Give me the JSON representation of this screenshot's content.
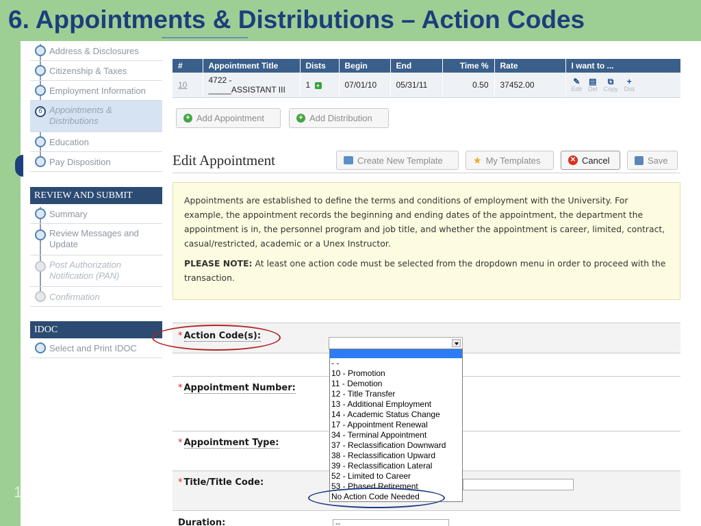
{
  "slide": {
    "title": "6. Appointments & Distributions – Action Codes"
  },
  "sidebar": {
    "top_items": [
      {
        "label": "Address & Disclosures"
      },
      {
        "label": "Citizenship & Taxes"
      },
      {
        "label": "Employment Information"
      },
      {
        "label": "Appointments & Distributions",
        "step": "6"
      },
      {
        "label": "Education"
      },
      {
        "label": "Pay Disposition"
      }
    ],
    "review_header": "REVIEW AND SUBMIT",
    "review_items": [
      {
        "label": "Summary"
      },
      {
        "label": "Review Messages and Update"
      },
      {
        "label": "Post Authorization Notification (PAN)"
      },
      {
        "label": "Confirmation"
      }
    ],
    "idoc_header": "IDOC",
    "idoc_items": [
      {
        "label": "Select and Print IDOC"
      }
    ]
  },
  "table": {
    "headers": [
      "#",
      "Appointment Title",
      "Dists",
      "Begin",
      "End",
      "Time %",
      "Rate",
      "I want to ..."
    ],
    "row": {
      "num": "10",
      "title_line1": "4722 -",
      "title_line2": "_____ASSISTANT III",
      "dists": "1",
      "begin": "07/01/10",
      "end": "05/31/11",
      "time": "0.50",
      "rate": "37452.00"
    },
    "actions": [
      "Edit",
      "Del",
      "Copy",
      "Dist"
    ]
  },
  "buttons": {
    "add_appointment": "Add Appointment",
    "add_distribution": "Add Distribution",
    "create_template": "Create New Template",
    "my_templates": "My Templates",
    "cancel": "Cancel",
    "save": "Save"
  },
  "edit": {
    "title": "Edit Appointment"
  },
  "notice": {
    "paragraph": "Appointments are established to define the terms and conditions of employment with the University. For example, the appointment records the beginning and ending dates of the appointment, the department the appointment is in, the personnel program and job title, and whether the appointment is career, limited, contract, casual/restricted, academic or a Unex Instructor.",
    "note_label": "PLEASE NOTE:",
    "note_text": " At least one action code must be selected from the dropdown menu in order to proceed with the transaction."
  },
  "form": {
    "required_mark": "*",
    "action_code_label": "Action Code(s):",
    "appointment_number_label": "Appointment Number:",
    "appointment_type_label": "Appointment Type:",
    "title_code_label": "Title/Title Code:",
    "duration_label": "Duration:",
    "duration_value": "--"
  },
  "dropdown": {
    "options": [
      "",
      "- -",
      "10 - Promotion",
      "11 - Demotion",
      "12 - Title Transfer",
      "13 - Additional Employment",
      "14 - Academic Status Change",
      "17 - Appointment Renewal",
      "34 - Terminal Appointment",
      "37 - Reclassification Downward",
      "38 - Reclassification Upward",
      "39 - Reclassification Lateral",
      "52 - Limited to Career",
      "53 - Phased Retirement",
      "No Action Code Needed"
    ]
  },
  "colors": {
    "slide_bg": "#9dcf95",
    "title": "#1c3e7c",
    "table_header": "#3a5f8b",
    "notice_bg": "#fdfce0",
    "dropdown_selected": "#2a7df5",
    "annotation_red": "#b22222",
    "annotation_blue": "#1d3c86"
  }
}
